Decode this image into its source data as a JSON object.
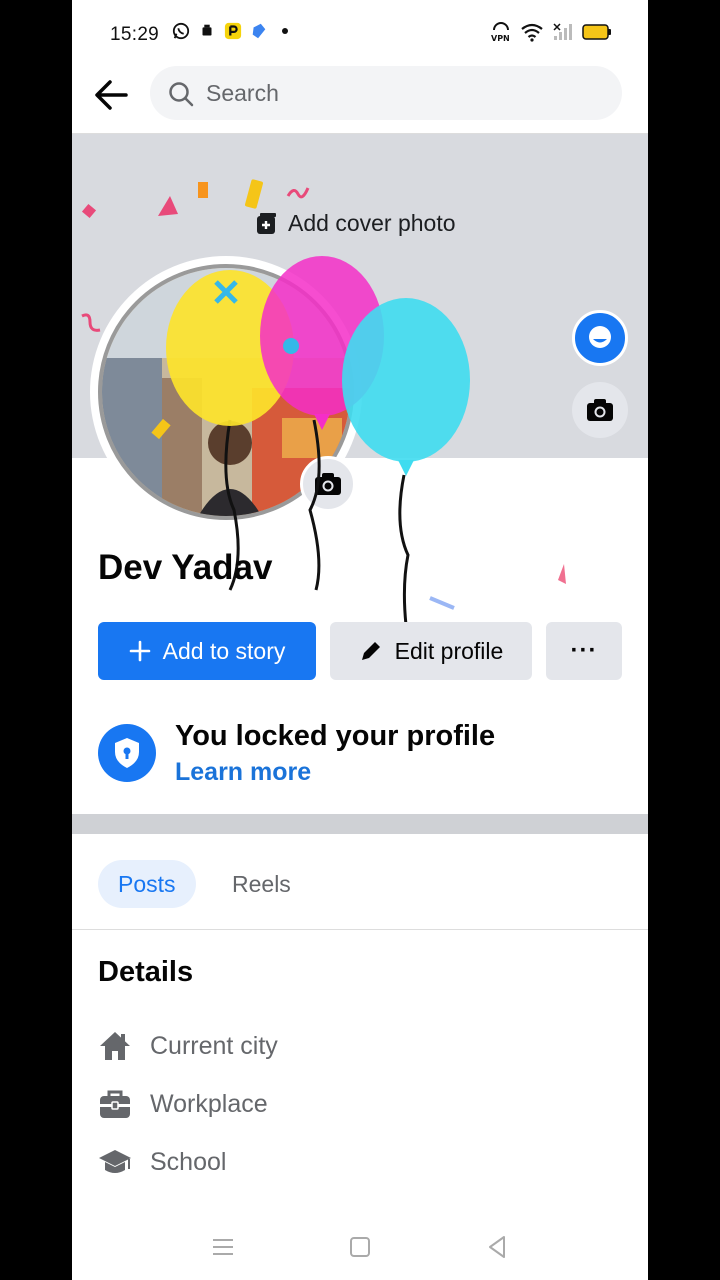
{
  "status_bar": {
    "time": "15:29"
  },
  "top_bar": {
    "search_placeholder": "Search"
  },
  "cover": {
    "add_cover_label": "Add cover photo"
  },
  "profile": {
    "name": "Dev Yadav"
  },
  "actions": {
    "add_story_label": "Add to story",
    "edit_profile_label": "Edit profile",
    "more_label": "···"
  },
  "locked": {
    "title": "You locked your profile",
    "learn_more": "Learn more"
  },
  "tabs": [
    {
      "label": "Posts",
      "active": true
    },
    {
      "label": "Reels",
      "active": false
    }
  ],
  "details": {
    "heading": "Details",
    "items": [
      {
        "label": "Current city",
        "icon": "home-icon"
      },
      {
        "label": "Workplace",
        "icon": "briefcase-icon"
      },
      {
        "label": "School",
        "icon": "graduation-cap-icon"
      }
    ]
  },
  "colors": {
    "accent": "#1877f2",
    "cover_bg": "#d8dadf",
    "button_grey": "#e4e6eb"
  }
}
